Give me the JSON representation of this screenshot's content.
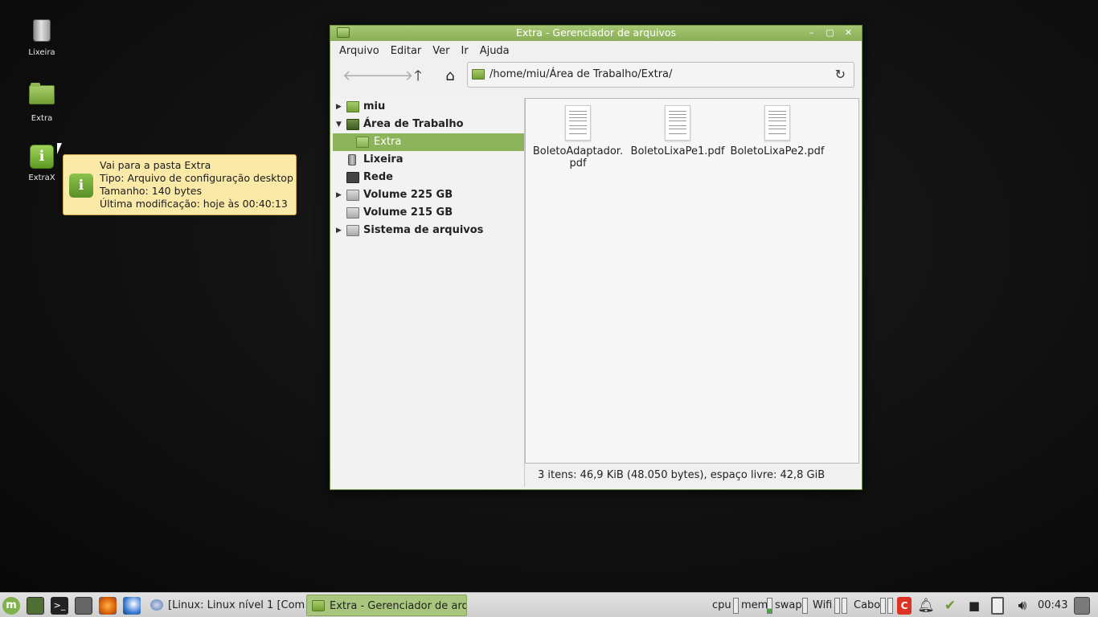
{
  "desktop": {
    "icons": [
      {
        "label": "Lixeira",
        "icon": "trash-icon"
      },
      {
        "label": "Extra",
        "icon": "folder-icon"
      },
      {
        "label": "ExtraX",
        "icon": "info-icon"
      }
    ],
    "tooltip": {
      "lines": [
        "Vai para a pasta Extra",
        "Tipo: Arquivo de configuração desktop",
        "Tamanho: 140 bytes",
        "Última modificação: hoje às 00:40:13"
      ],
      "icon": "info-icon"
    }
  },
  "window": {
    "title": "Extra - Gerenciador de arquivos",
    "menu": [
      "Arquivo",
      "Editar",
      "Ver",
      "Ir",
      "Ajuda"
    ],
    "address": "/home/miu/Área de Trabalho/Extra/",
    "sidebar": [
      {
        "label": "miu",
        "arrow": "▶",
        "icon": "home-folder-icon"
      },
      {
        "label": "Área de Trabalho",
        "arrow": "▼",
        "icon": "desktop-folder-icon"
      },
      {
        "label": "Extra",
        "arrow": "",
        "icon": "folder-icon",
        "selected": true
      },
      {
        "label": "Lixeira",
        "arrow": "",
        "icon": "trash-icon"
      },
      {
        "label": "Rede",
        "arrow": "",
        "icon": "network-icon"
      },
      {
        "label": "Volume 225 GB",
        "arrow": "▶",
        "icon": "drive-icon"
      },
      {
        "label": "Volume 215 GB",
        "arrow": "",
        "icon": "drive-icon"
      },
      {
        "label": "Sistema de arquivos",
        "arrow": "▶",
        "icon": "drive-icon"
      }
    ],
    "files": [
      {
        "line1": "BoletoAdaptador.",
        "line2": "pdf"
      },
      {
        "line1": "BoletoLixaPe1.pdf",
        "line2": ""
      },
      {
        "line1": "BoletoLixaPe2.pdf",
        "line2": ""
      }
    ],
    "status": "3 itens: 46,9 KiB (48.050 bytes), espaço livre: 42,8 GiB"
  },
  "taskbar": {
    "tasks": [
      {
        "label": "[Linux: Linux nível 1 [Com...",
        "active": false
      },
      {
        "label": "Extra - Gerenciador de arq...",
        "active": true
      }
    ],
    "monitors": [
      "cpu",
      "mem",
      "swap",
      "Wifi",
      "Cabo"
    ],
    "clock": "00:43"
  }
}
